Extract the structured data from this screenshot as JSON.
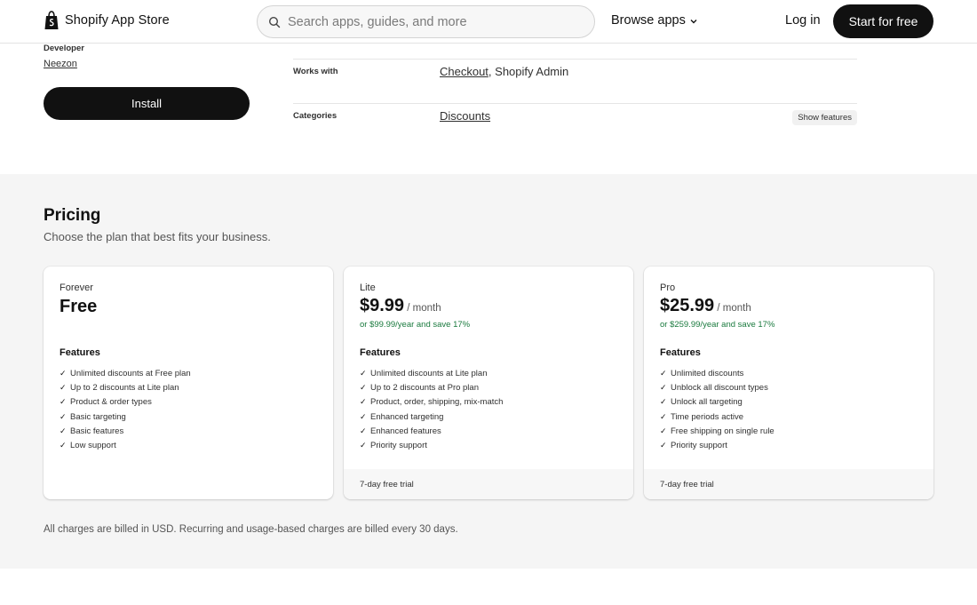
{
  "header": {
    "brand": "Shopify App Store",
    "search_placeholder": "Search apps, guides, and more",
    "browse": "Browse apps",
    "login": "Log in",
    "start": "Start for free"
  },
  "developer": {
    "label": "Developer",
    "name": "Neezon"
  },
  "install_label": "Install",
  "info": {
    "works_with_label": "Works with",
    "works_with_link": "Checkout",
    "works_with_rest": ", Shopify Admin",
    "categories_label": "Categories",
    "categories_link": "Discounts",
    "show_features": "Show features"
  },
  "pricing": {
    "title": "Pricing",
    "subtitle": "Choose the plan that best fits your business.",
    "plans": [
      {
        "name": "Forever",
        "price": "Free",
        "period": "",
        "yearly": "",
        "features_title": "Features",
        "features": [
          "Unlimited discounts at Free plan",
          "Up to 2 discounts at Lite plan",
          "Product & order types",
          "Basic targeting",
          "Basic features",
          "Low support"
        ],
        "trial": ""
      },
      {
        "name": "Lite",
        "price": "$9.99",
        "period": " / month",
        "yearly": "or $99.99/year and save 17%",
        "features_title": "Features",
        "features": [
          "Unlimited discounts at Lite plan",
          "Up to 2 discounts at Pro plan",
          "Product, order, shipping, mix-match",
          "Enhanced targeting",
          "Enhanced features",
          "Priority support"
        ],
        "trial": "7-day free trial"
      },
      {
        "name": "Pro",
        "price": "$25.99",
        "period": " / month",
        "yearly": "or $259.99/year and save 17%",
        "features_title": "Features",
        "features": [
          "Unlimited discounts",
          "Unblock all discount types",
          "Unlock all targeting",
          "Time periods active",
          "Free shipping on single rule",
          "Priority support"
        ],
        "trial": "7-day free trial"
      }
    ],
    "billing_note": "All charges are billed in USD. Recurring and usage-based charges are billed every 30 days."
  },
  "colors": {
    "accent_dark": "#111111",
    "savings_green": "#1a7a3e",
    "section_bg": "#f5f5f5"
  },
  "icons": {
    "brand": "shopping-bag-icon",
    "search": "search-icon",
    "dropdown": "chevron-down-icon",
    "feature": "checkmark-icon"
  }
}
